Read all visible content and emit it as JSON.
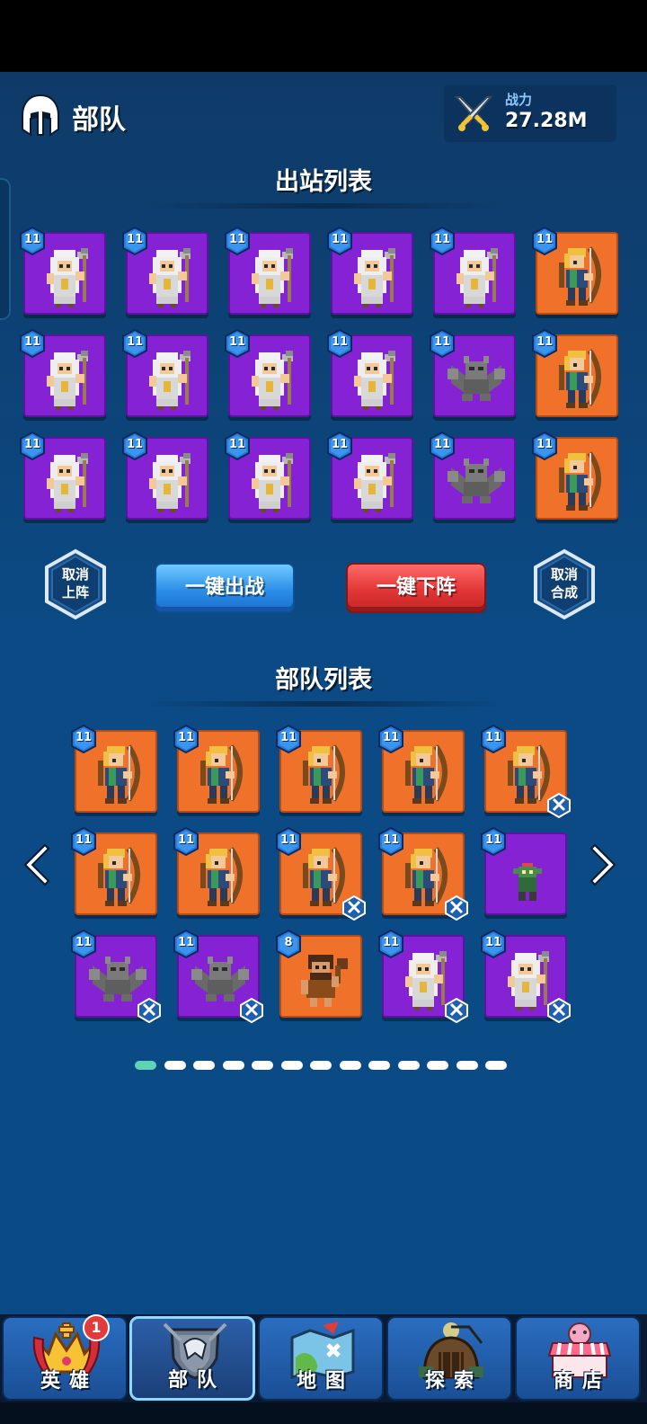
{
  "header": {
    "title": "部队",
    "power_label": "战力",
    "power_value": "27.28M"
  },
  "deploy_section": {
    "title": "出站列表",
    "rows": [
      [
        {
          "unit": "priest",
          "color": "purple",
          "level": "11"
        },
        {
          "unit": "priest",
          "color": "purple",
          "level": "11"
        },
        {
          "unit": "priest",
          "color": "purple",
          "level": "11"
        },
        {
          "unit": "priest",
          "color": "purple",
          "level": "11"
        },
        {
          "unit": "priest",
          "color": "purple",
          "level": "11"
        },
        {
          "unit": "archer",
          "color": "orange",
          "level": "11"
        }
      ],
      [
        {
          "unit": "priest",
          "color": "purple",
          "level": "11"
        },
        {
          "unit": "priest",
          "color": "purple",
          "level": "11"
        },
        {
          "unit": "priest",
          "color": "purple",
          "level": "11"
        },
        {
          "unit": "priest",
          "color": "purple",
          "level": "11"
        },
        {
          "unit": "gargoyle",
          "color": "purple",
          "level": "11"
        },
        {
          "unit": "archer",
          "color": "orange",
          "level": "11"
        }
      ],
      [
        {
          "unit": "priest",
          "color": "purple",
          "level": "11"
        },
        {
          "unit": "priest",
          "color": "purple",
          "level": "11"
        },
        {
          "unit": "priest",
          "color": "purple",
          "level": "11"
        },
        {
          "unit": "priest",
          "color": "purple",
          "level": "11"
        },
        {
          "unit": "gargoyle",
          "color": "purple",
          "level": "11"
        },
        {
          "unit": "archer",
          "color": "orange",
          "level": "11"
        }
      ]
    ]
  },
  "actions": {
    "cancel_deploy": [
      "取消",
      "上阵"
    ],
    "deploy_all": "一键出战",
    "undeploy_all": "一键下阵",
    "cancel_merge": [
      "取消",
      "合成"
    ]
  },
  "army_section": {
    "title": "部队列表",
    "rows": [
      [
        {
          "unit": "archer",
          "color": "orange",
          "level": "11",
          "merge": false
        },
        {
          "unit": "archer",
          "color": "orange",
          "level": "11",
          "merge": false
        },
        {
          "unit": "archer",
          "color": "orange",
          "level": "11",
          "merge": false
        },
        {
          "unit": "archer",
          "color": "orange",
          "level": "11",
          "merge": false
        },
        {
          "unit": "archer",
          "color": "orange",
          "level": "11",
          "merge": true
        }
      ],
      [
        {
          "unit": "archer",
          "color": "orange",
          "level": "11",
          "merge": false
        },
        {
          "unit": "archer",
          "color": "orange",
          "level": "11",
          "merge": false
        },
        {
          "unit": "archer",
          "color": "orange",
          "level": "11",
          "merge": true
        },
        {
          "unit": "archer",
          "color": "orange",
          "level": "11",
          "merge": true
        },
        {
          "unit": "goblin",
          "color": "purple",
          "level": "11",
          "merge": false
        }
      ],
      [
        {
          "unit": "gargoyle",
          "color": "purple",
          "level": "11",
          "merge": true
        },
        {
          "unit": "gargoyle",
          "color": "purple",
          "level": "11",
          "merge": true
        },
        {
          "unit": "caveman",
          "color": "orange",
          "level": "8",
          "merge": false
        },
        {
          "unit": "priest",
          "color": "purple",
          "level": "11",
          "merge": true
        },
        {
          "unit": "priest",
          "color": "purple",
          "level": "11",
          "merge": true
        }
      ]
    ],
    "page_count": 13,
    "current_page": 1
  },
  "nav": [
    {
      "label": "英雄",
      "icon": "crown-icon",
      "badge": "1"
    },
    {
      "label": "部队",
      "icon": "shield-icon",
      "active": true
    },
    {
      "label": "地图",
      "icon": "map-icon"
    },
    {
      "label": "探索",
      "icon": "cave-icon"
    },
    {
      "label": "商店",
      "icon": "shop-icon"
    }
  ],
  "colors": {
    "purple": "#8522d4",
    "orange": "#f0722a",
    "accent_dot": "#5fd3b4"
  }
}
